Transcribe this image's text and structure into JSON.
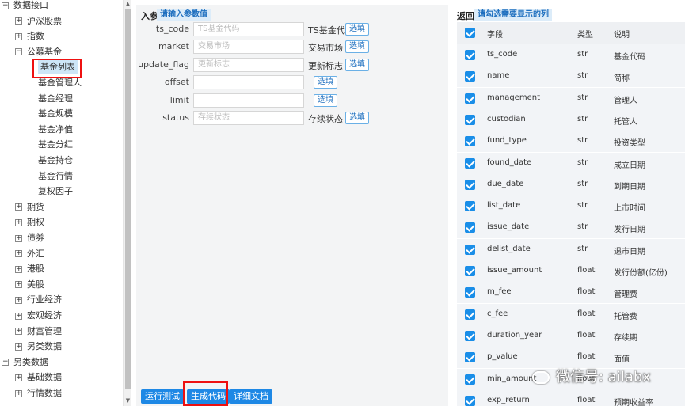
{
  "tree": {
    "root_label": "数据接口",
    "groups": [
      {
        "label": "沪深股票"
      },
      {
        "label": "指数"
      },
      {
        "label": "公募基金",
        "children": [
          "基金列表",
          "基金管理人",
          "基金经理",
          "基金规模",
          "基金净值",
          "基金分红",
          "基金持仓",
          "基金行情",
          "复权因子"
        ]
      },
      {
        "label": "期货"
      },
      {
        "label": "期权"
      },
      {
        "label": "债券"
      },
      {
        "label": "外汇"
      },
      {
        "label": "港股"
      },
      {
        "label": "美股"
      },
      {
        "label": "行业经济"
      },
      {
        "label": "宏观经济"
      },
      {
        "label": "财富管理"
      },
      {
        "label": "另类数据"
      }
    ],
    "root2_label": "另类数据",
    "root2_children": [
      "基础数据",
      "行情数据"
    ],
    "expanded_symbol": "−",
    "collapsed_symbol": "+"
  },
  "input_params": {
    "title": "入参",
    "hint": "请输入参数值",
    "rows": [
      {
        "name": "ts_code",
        "placeholder": "TS基金代码",
        "desc": "TS基金代码",
        "btn": "选填"
      },
      {
        "name": "market",
        "placeholder": "交易市场",
        "desc": "交易市场",
        "btn": "选填"
      },
      {
        "name": "update_flag",
        "placeholder": "更新标志",
        "desc": "更新标志",
        "btn": "选填"
      },
      {
        "name": "offset",
        "placeholder": "",
        "desc": "",
        "btn": "选填"
      },
      {
        "name": "limit",
        "placeholder": "",
        "desc": "",
        "btn": "选填"
      },
      {
        "name": "status",
        "placeholder": "存续状态",
        "desc": "存续状态",
        "btn": "选填"
      }
    ]
  },
  "actions": {
    "run": "运行测试",
    "generate": "生成代码",
    "docs": "详细文档"
  },
  "output": {
    "title": "返回",
    "hint": "请勾选需要显示的列",
    "headers": {
      "field": "字段",
      "type": "类型",
      "desc": "说明"
    },
    "rows": [
      {
        "field": "ts_code",
        "type": "str",
        "desc": "基金代码"
      },
      {
        "field": "name",
        "type": "str",
        "desc": "简称"
      },
      {
        "field": "management",
        "type": "str",
        "desc": "管理人"
      },
      {
        "field": "custodian",
        "type": "str",
        "desc": "托管人"
      },
      {
        "field": "fund_type",
        "type": "str",
        "desc": "投资类型"
      },
      {
        "field": "found_date",
        "type": "str",
        "desc": "成立日期"
      },
      {
        "field": "due_date",
        "type": "str",
        "desc": "到期日期"
      },
      {
        "field": "list_date",
        "type": "str",
        "desc": "上市时间"
      },
      {
        "field": "issue_date",
        "type": "str",
        "desc": "发行日期"
      },
      {
        "field": "delist_date",
        "type": "str",
        "desc": "退市日期"
      },
      {
        "field": "issue_amount",
        "type": "float",
        "desc": "发行份额(亿份)"
      },
      {
        "field": "m_fee",
        "type": "float",
        "desc": "管理费"
      },
      {
        "field": "c_fee",
        "type": "float",
        "desc": "托管费"
      },
      {
        "field": "duration_year",
        "type": "float",
        "desc": "存续期"
      },
      {
        "field": "p_value",
        "type": "float",
        "desc": "面值"
      },
      {
        "field": "min_amount",
        "type": "float",
        "desc": ""
      },
      {
        "field": "exp_return",
        "type": "float",
        "desc": "预期收益率"
      }
    ]
  },
  "watermark": "微信号: ailabx",
  "colors": {
    "accent": "#1e88e5",
    "checkbox": "#1a8ee8",
    "highlight": "#e11111",
    "panel_bg": "#f3f4f5"
  }
}
